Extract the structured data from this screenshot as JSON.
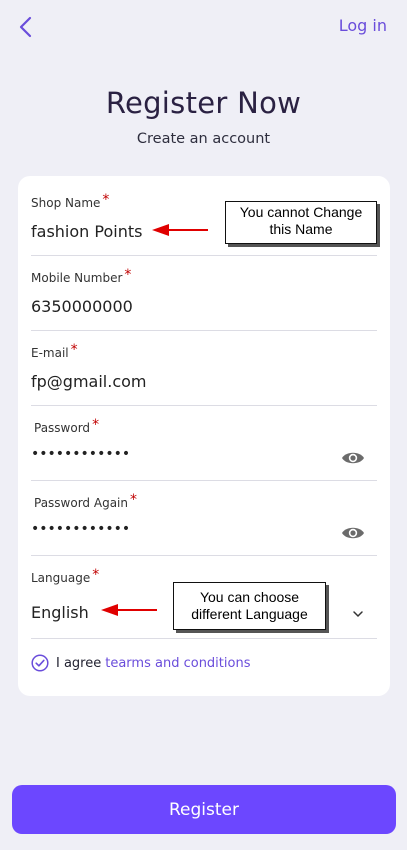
{
  "header": {
    "back_icon": "chevron-left-icon",
    "login_label": "Log in",
    "title": "Register Now",
    "subtitle": "Create an account"
  },
  "form": {
    "shop_name": {
      "label": "Shop Name",
      "required": "*",
      "value": "fashion Points"
    },
    "mobile": {
      "label": "Mobile Number",
      "required": "*",
      "value": "6350000000"
    },
    "email": {
      "label": "E-mail",
      "required": "*",
      "value": "fp@gmail.com"
    },
    "password": {
      "label": "Password",
      "required": "*",
      "value": "••••••••••••",
      "icon": "eye-icon"
    },
    "password_again": {
      "label": "Password Again",
      "required": "*",
      "value": "••••••••••••",
      "icon": "eye-icon"
    },
    "language": {
      "label": "Language",
      "required": "*",
      "value": "English",
      "icon": "chevron-down-icon"
    },
    "agree": {
      "prefix": "I agree",
      "link": "tearms and conditions",
      "icon": "check-circle-icon"
    }
  },
  "annotations": {
    "shop_name_note": "You cannot Change this Name",
    "language_note": "You can choose different Language"
  },
  "register_label": "Register",
  "colors": {
    "accent": "#6c47ff",
    "link": "#6a4ddb",
    "required": "#c00000",
    "arrow": "#e00000",
    "background": "#efeff6"
  }
}
